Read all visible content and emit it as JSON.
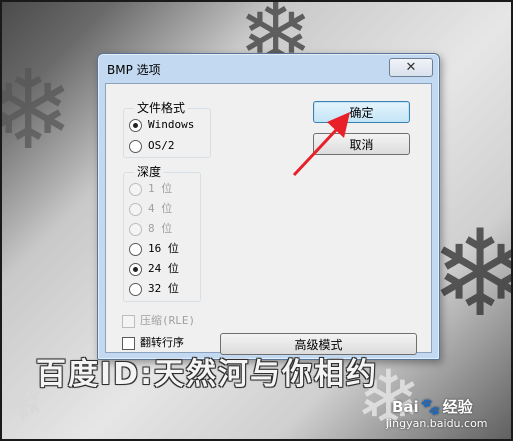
{
  "dialog": {
    "title": "BMP 选项",
    "close_glyph": "✕"
  },
  "file_format": {
    "label": "文件格式",
    "options": [
      {
        "label": "Windows",
        "checked": true
      },
      {
        "label": "OS/2",
        "checked": false
      }
    ]
  },
  "depth": {
    "label": "深度",
    "options": [
      {
        "label": "1 位",
        "checked": false,
        "disabled": true
      },
      {
        "label": "4 位",
        "checked": false,
        "disabled": true
      },
      {
        "label": "8 位",
        "checked": false,
        "disabled": true
      },
      {
        "label": "16 位",
        "checked": false,
        "disabled": false
      },
      {
        "label": "24 位",
        "checked": true,
        "disabled": false
      },
      {
        "label": "32 位",
        "checked": false,
        "disabled": false
      }
    ]
  },
  "compress": {
    "label": "压缩(RLE)",
    "checked": false,
    "disabled": true
  },
  "flip": {
    "label": "翻转行序",
    "checked": false
  },
  "buttons": {
    "ok": "确定",
    "cancel": "取消",
    "advanced": "高级模式"
  },
  "watermark": {
    "text": "百度ID:天然河与你相约",
    "logo_prefix": "Bai",
    "logo_paw": "🐾",
    "logo_suffix": "经验",
    "site": "jingyan.baidu.com"
  },
  "colors": {
    "arrow": "#e8202a",
    "title_bar": "#c3d9f1",
    "default_button": "#c4e5f6"
  },
  "background_icons": [
    "snowflake-icon"
  ]
}
